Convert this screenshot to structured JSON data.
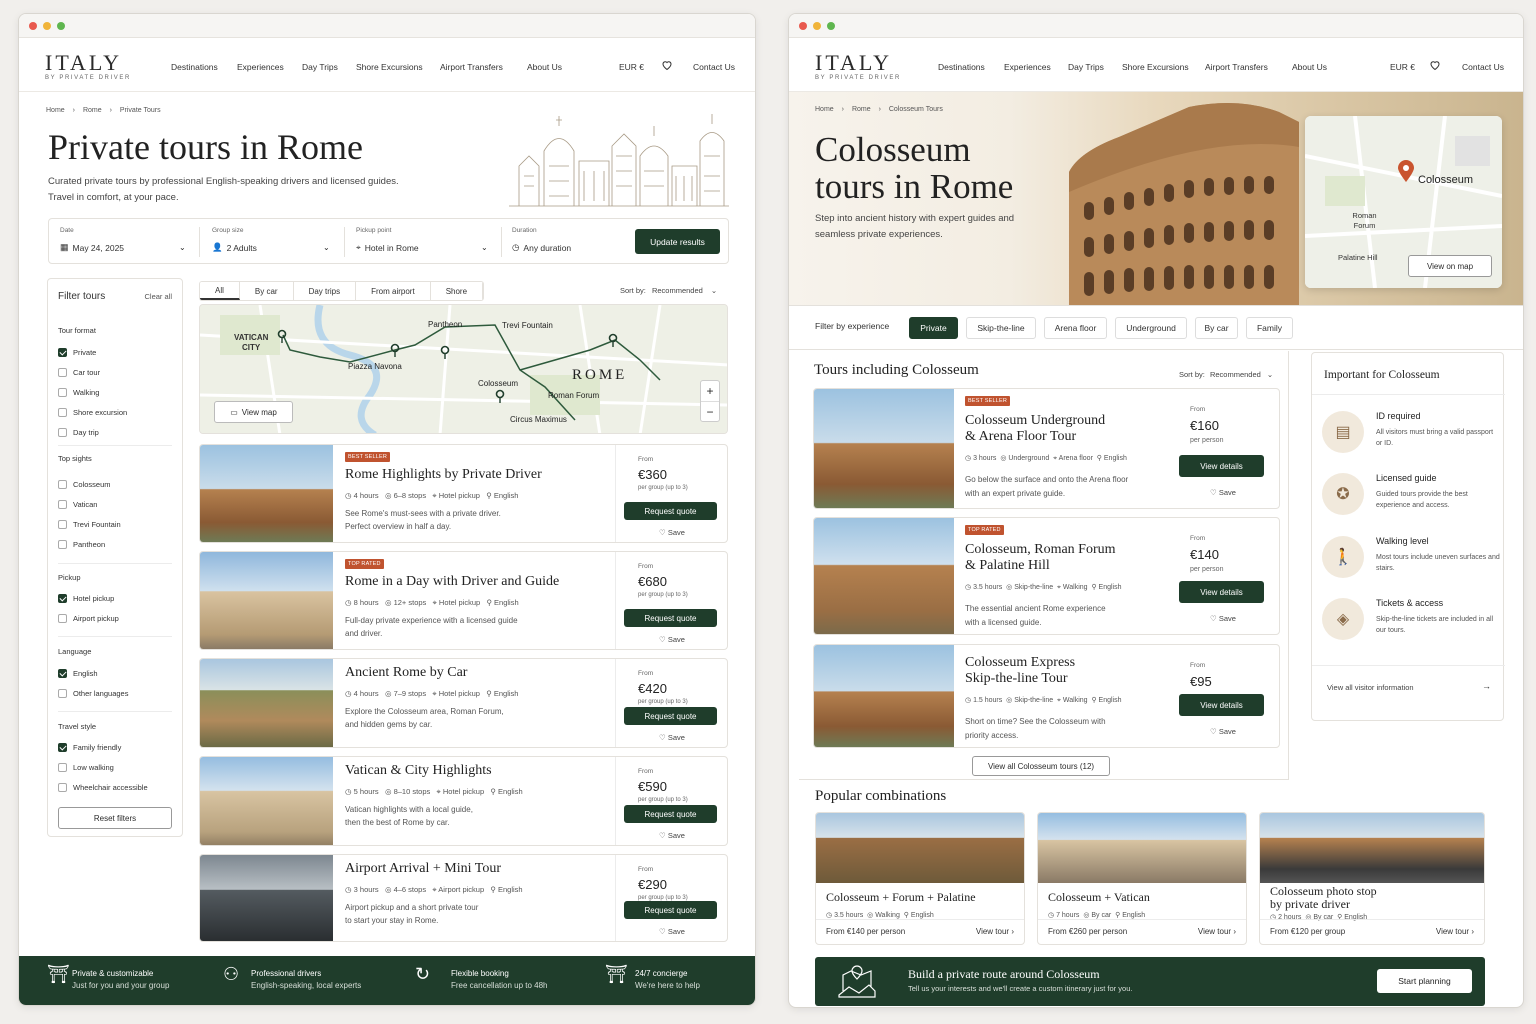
{
  "left": {
    "nav": {
      "logo": "ITALY",
      "logo_sub": "BY PRIVATE DRIVER",
      "items": [
        "Destinations",
        "Experiences",
        "Day Trips",
        "Shore Excursions",
        "Airport Transfers",
        "About Us"
      ],
      "currency": "EUR €",
      "contact": "Contact Us"
    },
    "breadcrumb": [
      "Home",
      "Rome",
      "Private Tours"
    ],
    "title": "Private tours in Rome",
    "subtitle": "Curated private tours by professional English-speaking drivers and licensed guides. Travel in comfort, at your pace.",
    "search": {
      "date_label": "Date",
      "date": "May 24, 2025",
      "group_label": "Group size",
      "group": "2 Adults",
      "pickup_label": "Pickup point",
      "pickup": "Hotel in Rome",
      "duration_label": "Duration",
      "duration": "Any duration",
      "button": "Update results"
    },
    "filters": {
      "title": "Filter tours",
      "clear": "Clear all",
      "sections": [
        {
          "name": "Tour format",
          "items": [
            {
              "label": "Private",
              "checked": true
            },
            {
              "label": "Car tour",
              "checked": false
            },
            {
              "label": "Walking",
              "checked": false
            },
            {
              "label": "Shore excursion",
              "checked": false
            },
            {
              "label": "Day trip",
              "checked": false
            }
          ]
        },
        {
          "name": "Top sights",
          "items": [
            {
              "label": "Colosseum",
              "checked": false
            },
            {
              "label": "Vatican",
              "checked": false
            },
            {
              "label": "Trevi Fountain",
              "checked": false
            },
            {
              "label": "Pantheon",
              "checked": false
            }
          ]
        },
        {
          "name": "Pickup",
          "items": [
            {
              "label": "Hotel pickup",
              "checked": true
            },
            {
              "label": "Airport pickup",
              "checked": false
            }
          ]
        },
        {
          "name": "Language",
          "items": [
            {
              "label": "English",
              "checked": true
            },
            {
              "label": "Other languages",
              "checked": false
            }
          ]
        },
        {
          "name": "Travel style",
          "items": [
            {
              "label": "Family friendly",
              "checked": true
            },
            {
              "label": "Low walking",
              "checked": false
            },
            {
              "label": "Wheelchair accessible",
              "checked": false
            }
          ]
        }
      ],
      "reset": "Reset filters"
    },
    "tabs": [
      "All",
      "By car",
      "Day trips",
      "From airport",
      "Shore"
    ],
    "sort_label": "Sort by:",
    "sort_value": "Recommended",
    "map": {
      "labels": [
        "VATICAN",
        "CITY",
        "Pantheon",
        "Trevi Fountain",
        "Piazza Navona",
        "Colosseum",
        "ROME",
        "Roman Forum",
        "Circus Maximus"
      ],
      "view_map": "View map"
    },
    "tours": [
      {
        "badge": "BEST SELLER",
        "title": "Rome Highlights by Private Driver",
        "hours": "4 hours",
        "stops": "6–8 stops",
        "pickup": "Hotel pickup",
        "lang": "English",
        "desc1": "See Rome's must-sees with a private driver.",
        "desc2": "Perfect overview in half a day.",
        "from": "From",
        "price": "€360",
        "per": "per group (up to 3)",
        "cta": "Request quote",
        "save": "Save"
      },
      {
        "badge": "TOP RATED",
        "title": "Rome in a Day with Driver and Guide",
        "hours": "8 hours",
        "stops": "12+ stops",
        "pickup": "Hotel pickup",
        "lang": "English",
        "desc1": "Full-day private experience with a licensed guide",
        "desc2": "and driver.",
        "from": "From",
        "price": "€680",
        "per": "per group (up to 3)",
        "cta": "Request quote",
        "save": "Save"
      },
      {
        "badge": "",
        "title": "Ancient Rome by Car",
        "hours": "4 hours",
        "stops": "7–9 stops",
        "pickup": "Hotel pickup",
        "lang": "English",
        "desc1": "Explore the Colosseum area, Roman Forum,",
        "desc2": "and hidden gems by car.",
        "from": "From",
        "price": "€420",
        "per": "per group (up to 3)",
        "cta": "Request quote",
        "save": "Save"
      },
      {
        "badge": "",
        "title": "Vatican & City Highlights",
        "hours": "5 hours",
        "stops": "8–10 stops",
        "pickup": "Hotel pickup",
        "lang": "English",
        "desc1": "Vatican highlights with a local guide,",
        "desc2": "then the best of Rome by car.",
        "from": "From",
        "price": "€590",
        "per": "per group (up to 3)",
        "cta": "Request quote",
        "save": "Save"
      },
      {
        "badge": "",
        "title": "Airport Arrival + Mini Tour",
        "hours": "3 hours",
        "stops": "4–6 stops",
        "pickup": "Airport pickup",
        "lang": "English",
        "desc1": "Airport pickup and a short private tour",
        "desc2": "to start your stay in Rome.",
        "from": "From",
        "price": "€290",
        "per": "per group (up to 3)",
        "cta": "Request quote",
        "save": "Save"
      }
    ],
    "footer": [
      {
        "t1": "Private & customizable",
        "t2": "Just for you and your group"
      },
      {
        "t1": "Professional drivers",
        "t2": "English-speaking, local experts"
      },
      {
        "t1": "Flexible booking",
        "t2": "Free cancellation up to 48h"
      },
      {
        "t1": "24/7 concierge",
        "t2": "We're here to help"
      }
    ]
  },
  "right": {
    "breadcrumb": [
      "Home",
      "Rome",
      "Colosseum Tours"
    ],
    "title1": "Colosseum",
    "title2": "tours in Rome",
    "subtitle": "Step into ancient history with expert guides and seamless private experiences.",
    "map": {
      "pin": "Colosseum",
      "forum": "Roman Forum",
      "palatine": "Palatine Hill",
      "view": "View on map"
    },
    "filter_label": "Filter by experience",
    "pills": [
      "Private",
      "Skip-the-line",
      "Arena floor",
      "Underground",
      "By car",
      "Family"
    ],
    "list_title": "Tours including Colosseum",
    "sort_label": "Sort by:",
    "sort_value": "Recommended",
    "tours": [
      {
        "badge": "BEST SELLER",
        "t1": "Colosseum Underground",
        "t2": "& Arena Floor Tour",
        "meta": [
          "3 hours",
          "Underground",
          "Arena floor",
          "English"
        ],
        "desc1": "Go below the surface and onto the Arena floor",
        "desc2": "with an expert private guide.",
        "from": "From",
        "price": "€160",
        "per": "per person",
        "cta": "View details",
        "save": "Save"
      },
      {
        "badge": "TOP RATED",
        "t1": "Colosseum, Roman Forum",
        "t2": "& Palatine Hill",
        "meta": [
          "3.5 hours",
          "Skip-the-line",
          "Walking",
          "English"
        ],
        "desc1": "The essential ancient Rome experience",
        "desc2": "with a licensed guide.",
        "from": "From",
        "price": "€140",
        "per": "per person",
        "cta": "View details",
        "save": "Save"
      },
      {
        "badge": "",
        "t1": "Colosseum Express",
        "t2": "Skip-the-line Tour",
        "meta": [
          "1.5 hours",
          "Skip-the-line",
          "Walking",
          "English"
        ],
        "desc1": "Short on time? See the Colosseum with",
        "desc2": "priority access.",
        "from": "From",
        "price": "€95",
        "per": "per person",
        "cta": "View details",
        "save": "Save"
      }
    ],
    "view_all": "View all Colosseum tours (12)",
    "important": {
      "title": "Important for Colosseum",
      "items": [
        {
          "t": "ID required",
          "d": "All visitors must bring a valid passport or ID."
        },
        {
          "t": "Licensed guide",
          "d": "Guided tours provide the best experience and access."
        },
        {
          "t": "Walking level",
          "d": "Most tours include uneven surfaces and stairs."
        },
        {
          "t": "Tickets & access",
          "d": "Skip-the-line tickets are included in all our tours."
        }
      ],
      "link": "View all visitor information"
    },
    "popular_title": "Popular combinations",
    "combos": [
      {
        "t1": "Colosseum + Forum + Palatine",
        "t2": "",
        "meta": [
          "3.5 hours",
          "Walking",
          "English"
        ],
        "price": "From €140 per person",
        "view": "View tour"
      },
      {
        "t1": "Colosseum + Vatican",
        "t2": "",
        "meta": [
          "7 hours",
          "By car",
          "English"
        ],
        "price": "From €260 per person",
        "view": "View tour"
      },
      {
        "t1": "Colosseum photo stop",
        "t2": "by private driver",
        "meta": [
          "2 hours",
          "By car",
          "English"
        ],
        "price": "From €120 per group",
        "view": "View tour"
      }
    ],
    "banner": {
      "title": "Build a private route around Colosseum",
      "sub": "Tell us your interests and we'll create a custom itinerary just for you.",
      "cta": "Start planning"
    }
  }
}
